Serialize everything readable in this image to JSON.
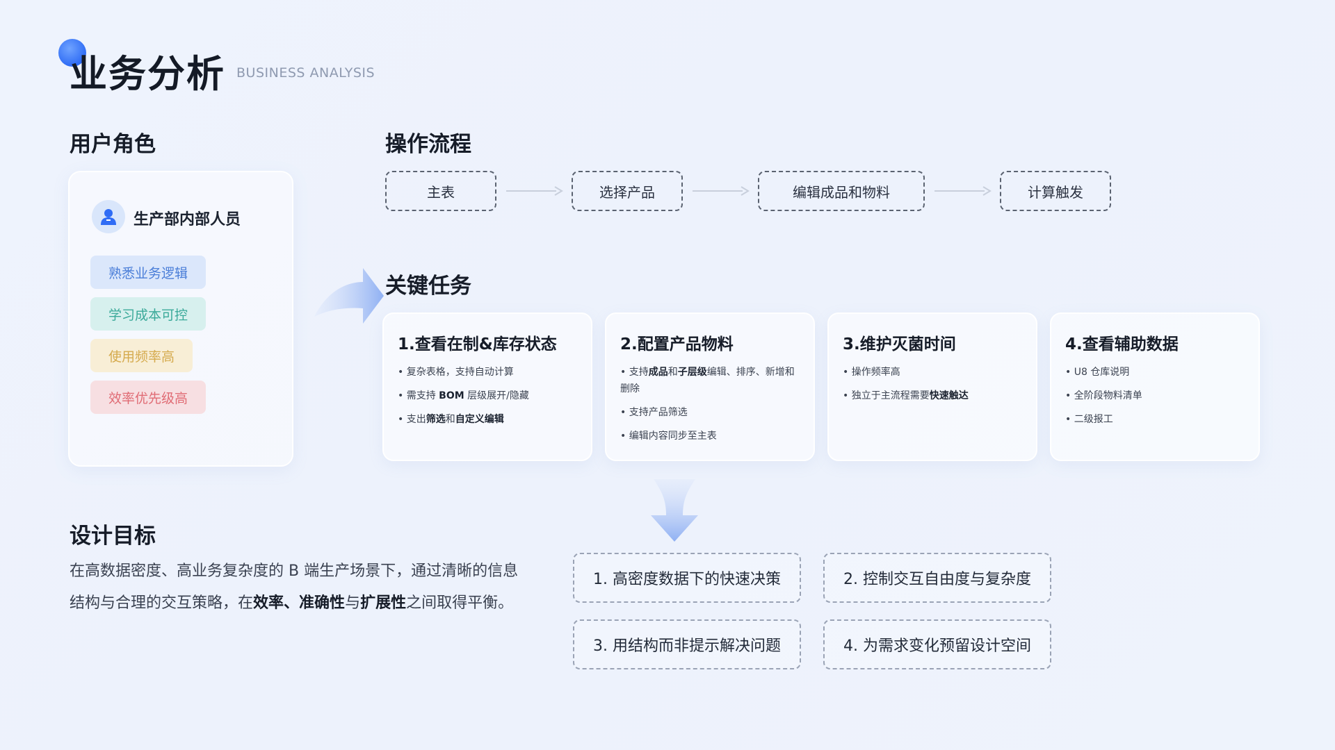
{
  "header": {
    "title": "业务分析",
    "subtitle": "BUSINESS ANALYSIS"
  },
  "user_roles": {
    "section_title": "用户角色",
    "role_name": "生产部内部人员",
    "tags": [
      "熟悉业务逻辑",
      "学习成本可控",
      "使用频率高",
      "效率优先级高"
    ],
    "tag_colors": [
      "#4a7ed8",
      "#3aa999",
      "#d5aa4d",
      "#e06b74"
    ]
  },
  "flow": {
    "section_title": "操作流程",
    "steps": [
      "主表",
      "选择产品",
      "编辑成品和物料",
      "计算触发"
    ]
  },
  "tasks": {
    "section_title": "关键任务",
    "cards": [
      {
        "title": "1.查看在制&库存状态",
        "items": [
          {
            "pre": "• 复杂表格，支持自动计算",
            "b1": "",
            "mid": "",
            "b2": "",
            "post": ""
          },
          {
            "pre": "• 需支持 ",
            "b1": "BOM",
            "mid": " 层级展开/隐藏",
            "b2": "",
            "post": ""
          },
          {
            "pre": "• 支出",
            "b1": "筛选",
            "mid": "和",
            "b2": "自定义编辑",
            "post": ""
          }
        ]
      },
      {
        "title": "2.配置产品物料",
        "items": [
          {
            "pre": "• 支持",
            "b1": "成品",
            "mid": "和",
            "b2": "子层级",
            "post": "编辑、排序、新增和删除"
          },
          {
            "pre": "• 支持产品筛选",
            "b1": "",
            "mid": "",
            "b2": "",
            "post": ""
          },
          {
            "pre": "• 编辑内容同步至主表",
            "b1": "",
            "mid": "",
            "b2": "",
            "post": ""
          }
        ]
      },
      {
        "title": "3.维护灭菌时间",
        "items": [
          {
            "pre": "• 操作频率高",
            "b1": "",
            "mid": "",
            "b2": "",
            "post": ""
          },
          {
            "pre": "• 独立于主流程需要",
            "b1": "快速触达",
            "mid": "",
            "b2": "",
            "post": ""
          }
        ]
      },
      {
        "title": "4.查看辅助数据",
        "items": [
          {
            "pre": "• U8 仓库说明",
            "b1": "",
            "mid": "",
            "b2": "",
            "post": ""
          },
          {
            "pre": "• 全阶段物料清单",
            "b1": "",
            "mid": "",
            "b2": "",
            "post": ""
          },
          {
            "pre": "• 二级报工",
            "b1": "",
            "mid": "",
            "b2": "",
            "post": ""
          }
        ]
      }
    ]
  },
  "design_goals": {
    "section_title": "设计目标",
    "desc_pre": "在高数据密度、高业务复杂度的 B 端生产场景下，通过清晰的信息结构与合理的交互策略，在",
    "desc_b1": "效率",
    "desc_sep1": "、",
    "desc_b2": "准确性",
    "desc_sep2": "与",
    "desc_b3": "扩展性",
    "desc_post": "之间取得平衡。",
    "goals": [
      "1. 高密度数据下的快速决策",
      "2. 控制交互自由度与复杂度",
      "3. 用结构而非提示解决问题",
      "4. 为需求变化预留设计空间"
    ]
  }
}
